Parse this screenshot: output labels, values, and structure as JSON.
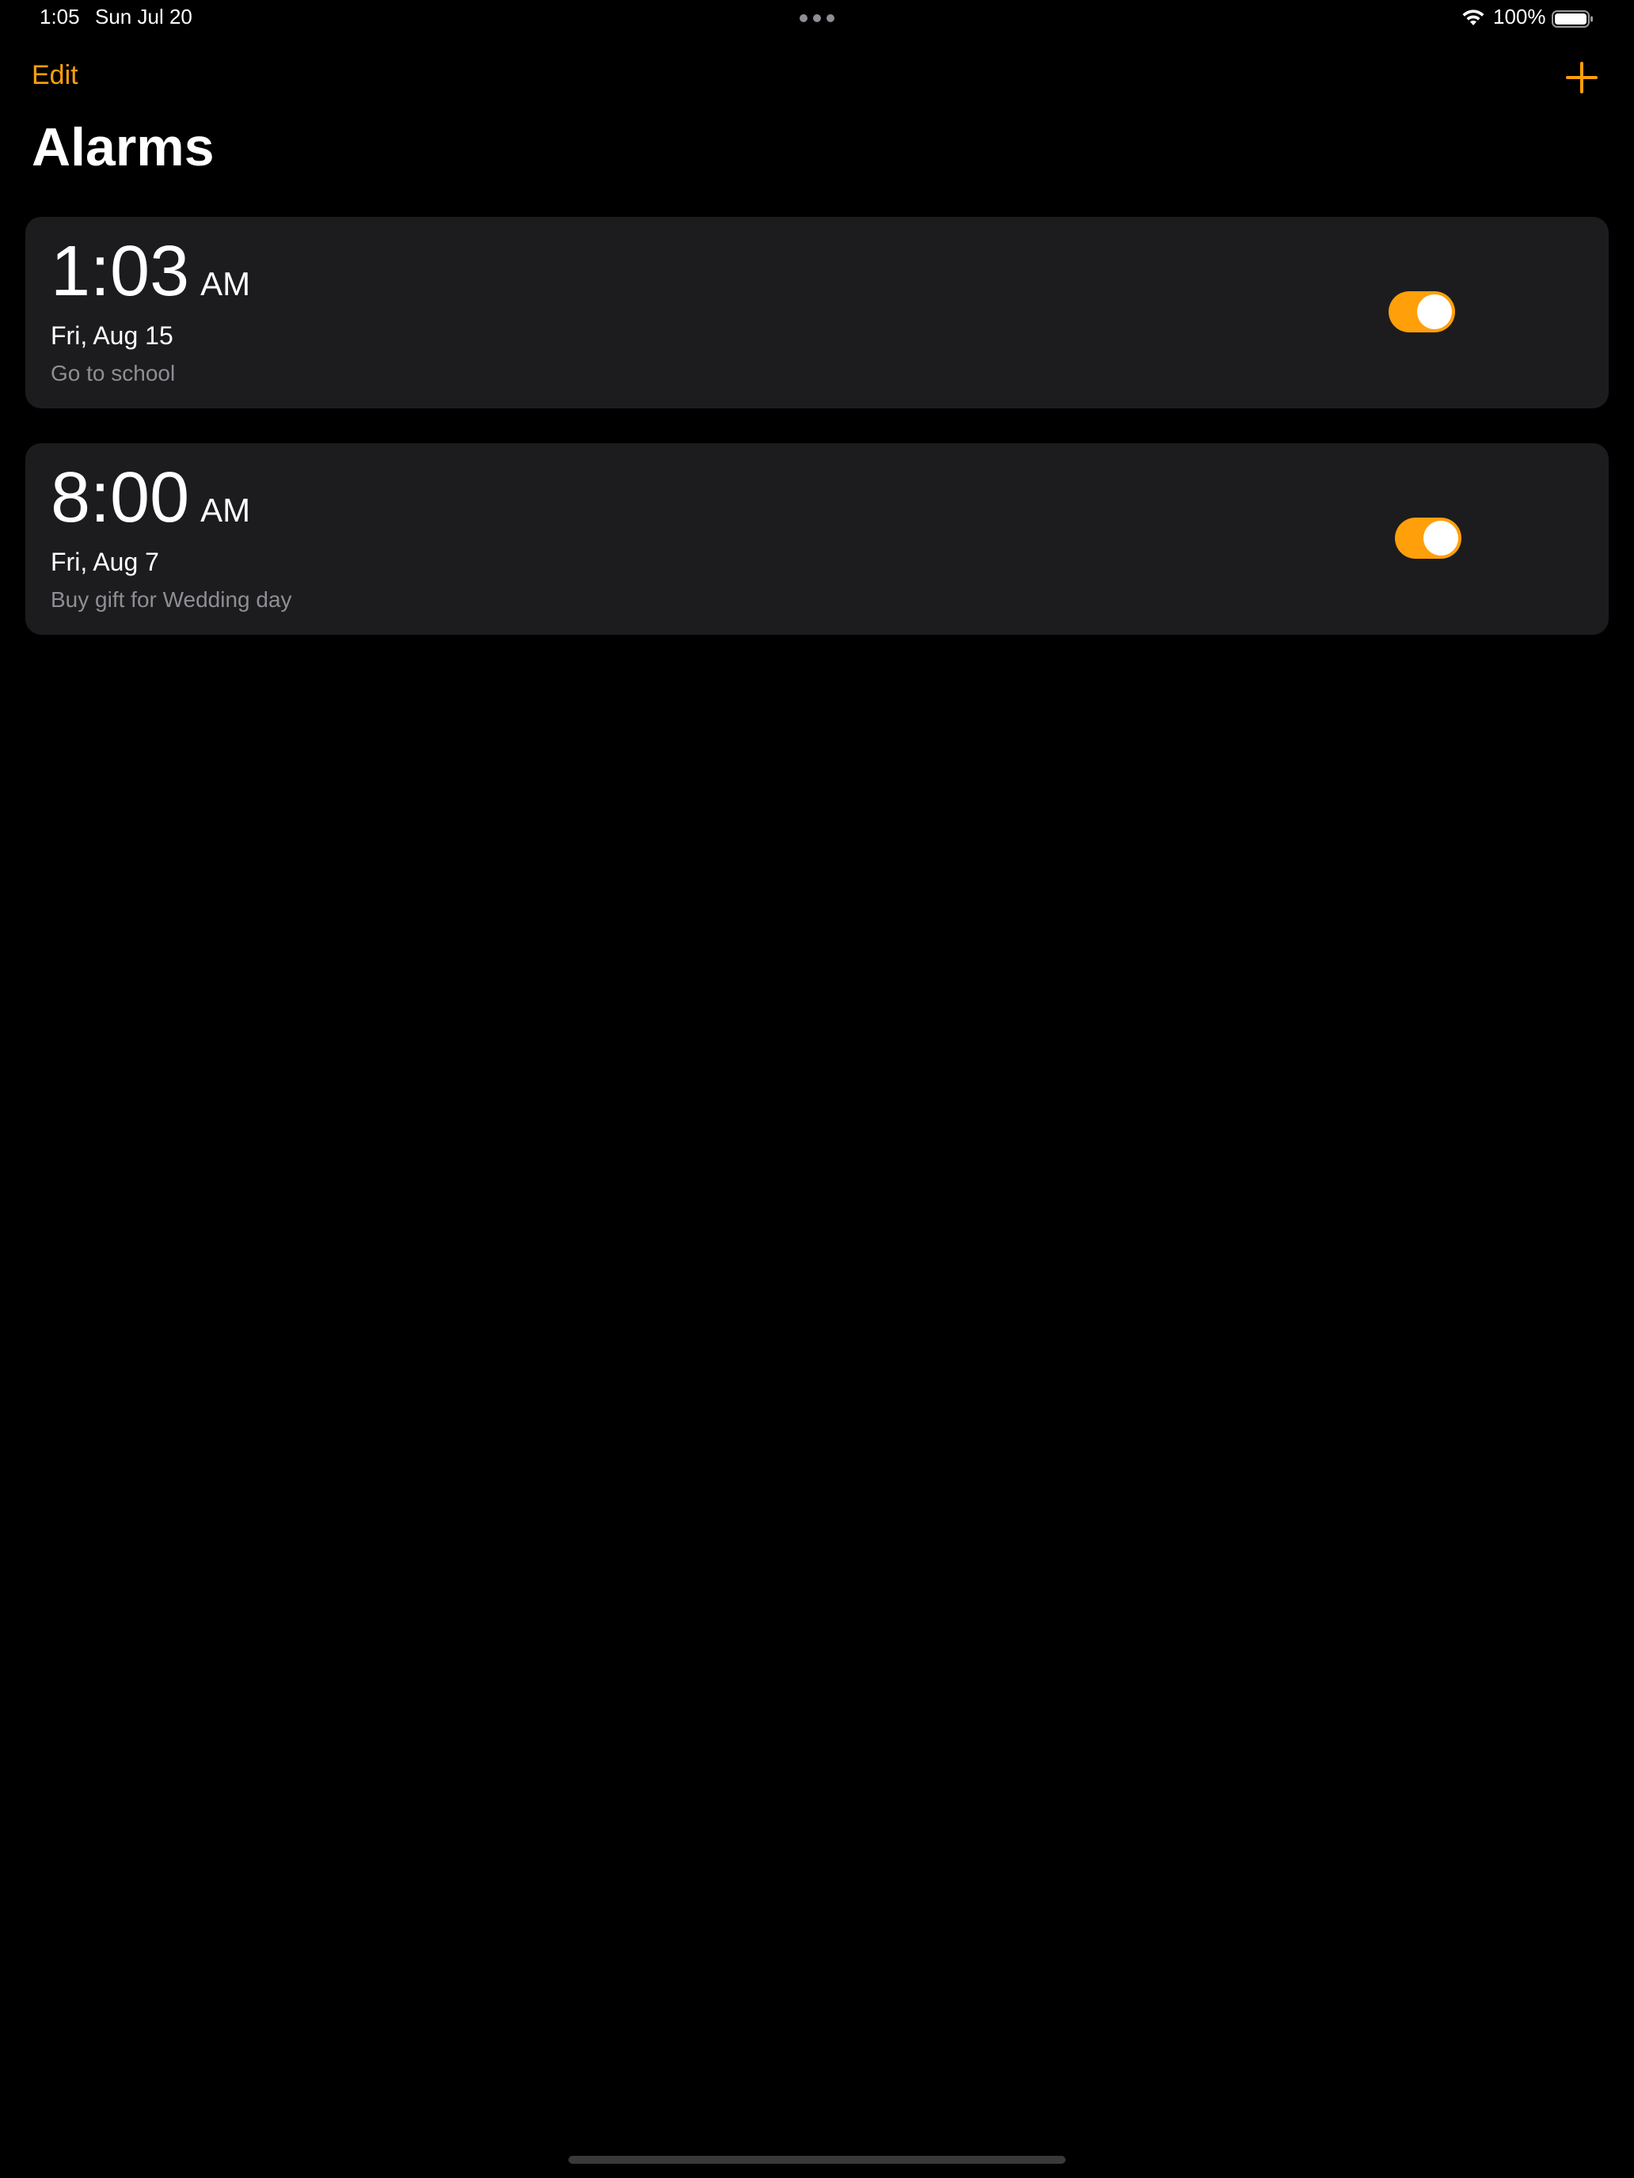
{
  "status_bar": {
    "time": "1:05",
    "date": "Sun Jul 20",
    "battery": "100%",
    "wifi_icon": "wifi-icon",
    "battery_icon": "battery-icon"
  },
  "nav": {
    "edit_label": "Edit",
    "add_icon": "plus-icon",
    "title": "Alarms"
  },
  "alarms": [
    {
      "time": "1:03",
      "ampm": "AM",
      "date": "Fri, Aug 15",
      "label": "Go to school",
      "enabled": true
    },
    {
      "time": "8:00",
      "ampm": "AM",
      "date": "Fri, Aug 7",
      "label": "Buy gift for Wedding day",
      "enabled": true
    }
  ],
  "colors": {
    "accent": "#ff9f0a",
    "background": "#000000",
    "card": "#1c1c1e",
    "secondary_text": "#8e8e93"
  }
}
